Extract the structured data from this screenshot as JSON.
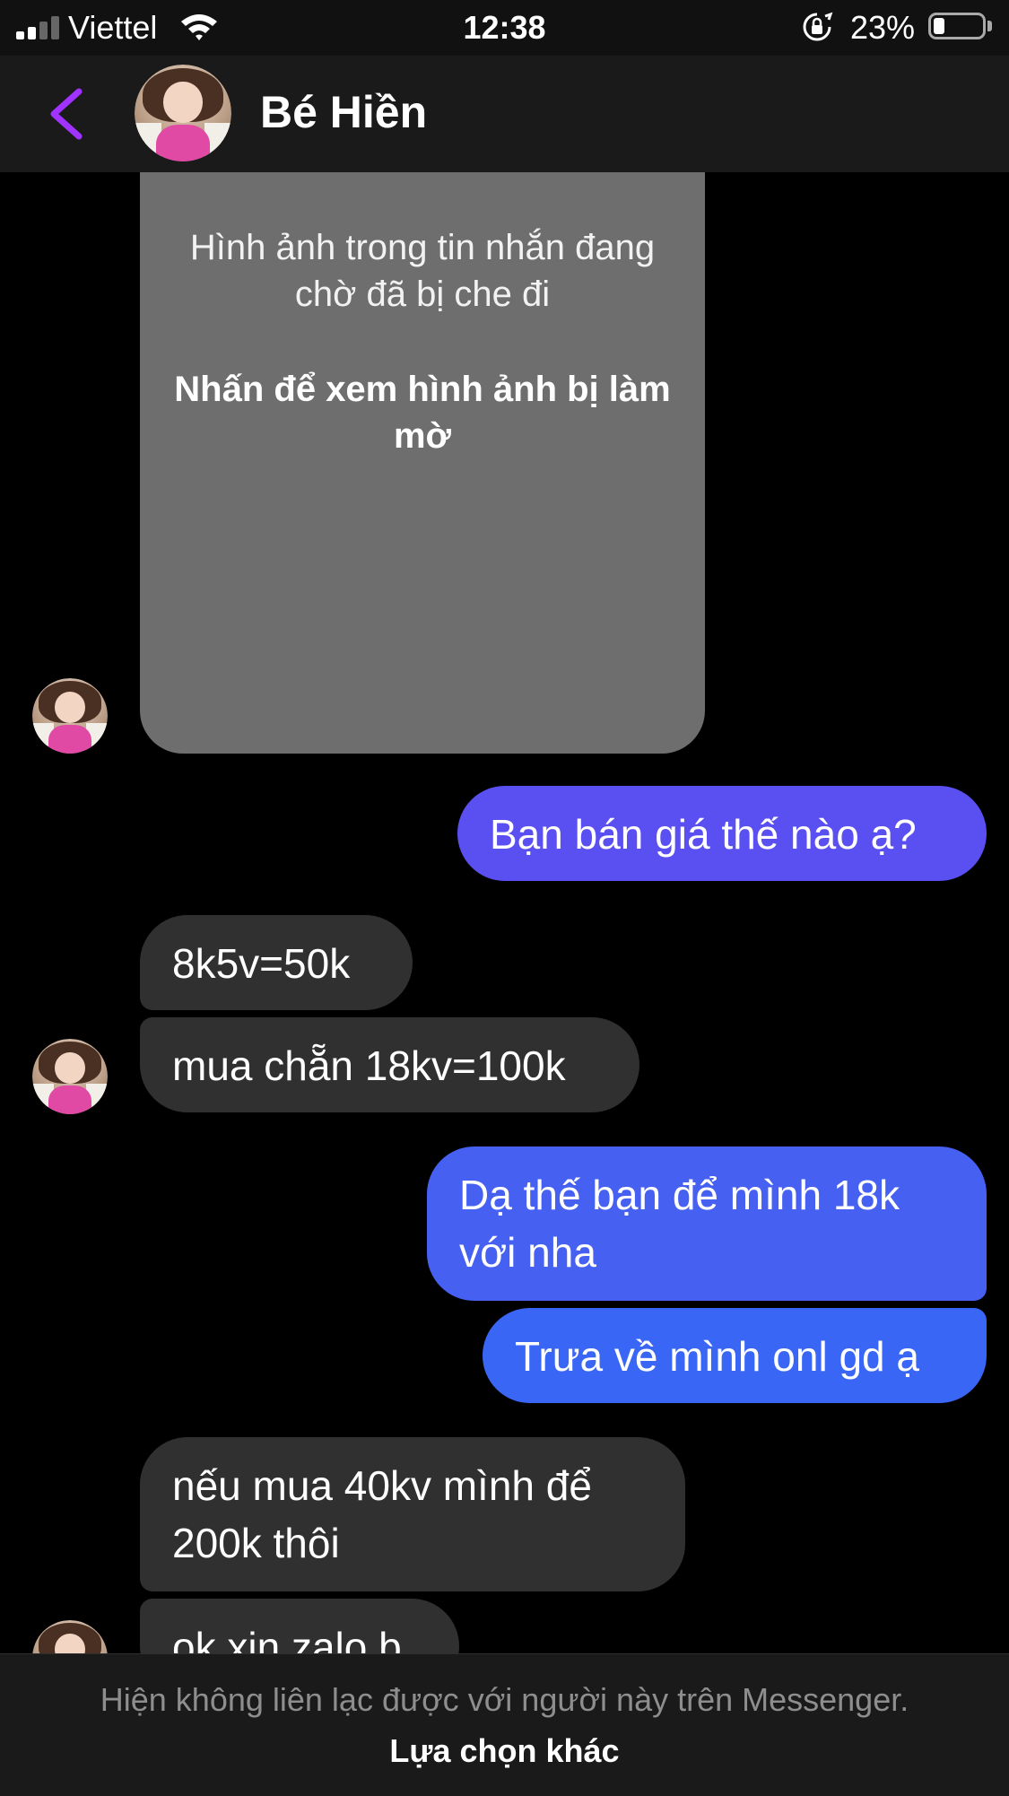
{
  "status_bar": {
    "carrier": "Viettel",
    "time": "12:38",
    "battery_percent": "23%",
    "battery_level": 0.23,
    "signal_bars_filled": 2,
    "signal_bars_total": 4,
    "icons": [
      "signal-icon",
      "wifi-icon",
      "orientation-lock-icon",
      "battery-icon"
    ]
  },
  "header": {
    "contact_name": "Bé Hiền",
    "back_icon": "chevron-left-icon",
    "accent_color": "#a033ff"
  },
  "messages": {
    "blurred_image": {
      "notice": "Hình ảnh trong tin nhắn đang chờ đã bị che đi",
      "action": "Nhấn để xem hình ảnh bị làm mờ"
    },
    "m1": "Bạn bán giá thế nào ạ?",
    "m2": "8k5v=50k",
    "m3": "mua chẵn 18kv=100k",
    "m4": "Dạ thế bạn để mình 18k với nha",
    "m5": "Trưa về mình onl gd ạ",
    "m6": "nếu mua 40kv mình để 200k thôi",
    "m7": "ok xin zalo b"
  },
  "colors": {
    "incoming_bubble": "#303030",
    "outgoing_purple": "#5a4ff0",
    "outgoing_blue": "#3a66f5",
    "background": "#000000"
  },
  "footer": {
    "notice": "Hiện không liên lạc được với người này trên Messenger.",
    "link": "Lựa chọn khác"
  }
}
